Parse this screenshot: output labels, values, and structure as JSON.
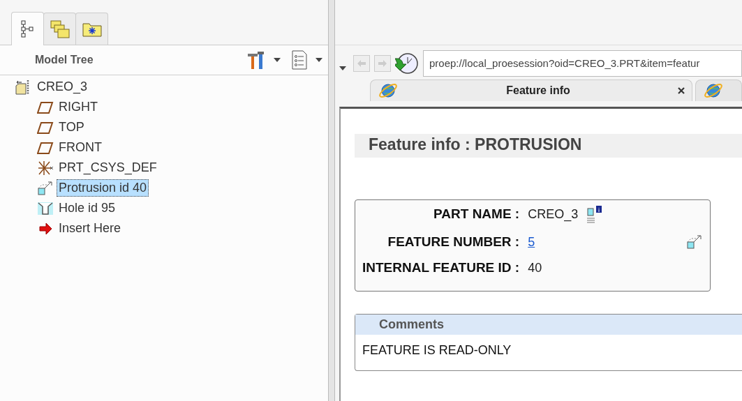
{
  "left_tabs": [
    {
      "kind": "tree",
      "selected": true
    },
    {
      "kind": "folders",
      "selected": false
    },
    {
      "kind": "favorites",
      "selected": false
    }
  ],
  "model_tree": {
    "title": "Model Tree",
    "root": {
      "label": "CREO_3",
      "kind": "part",
      "selected": false,
      "children": [
        {
          "label": "RIGHT",
          "kind": "plane",
          "selected": false
        },
        {
          "label": "TOP",
          "kind": "plane",
          "selected": false
        },
        {
          "label": "FRONT",
          "kind": "plane",
          "selected": false
        },
        {
          "label": "PRT_CSYS_DEF",
          "kind": "csys",
          "selected": false
        },
        {
          "label": "Protrusion id 40",
          "kind": "protrusion",
          "selected": true
        },
        {
          "label": "Hole id 95",
          "kind": "hole",
          "selected": false
        },
        {
          "label": "Insert Here",
          "kind": "insert",
          "selected": false
        }
      ]
    }
  },
  "browser": {
    "url": "proep://local_proesession?oid=CREO_3.PRT&item=featur",
    "tabs": [
      {
        "label": "Feature info",
        "selected": true
      },
      {
        "selected": false
      }
    ],
    "heading": "Feature info : PROTRUSION",
    "info_rows": [
      {
        "label": "PART NAME :",
        "value": "CREO_3",
        "kind": "text"
      },
      {
        "label": "FEATURE NUMBER :",
        "value": "5",
        "kind": "link"
      },
      {
        "label": "INTERNAL FEATURE ID :",
        "value": "40",
        "kind": "text"
      }
    ],
    "comments": {
      "title": "Comments",
      "text": "FEATURE IS READ-ONLY"
    }
  }
}
